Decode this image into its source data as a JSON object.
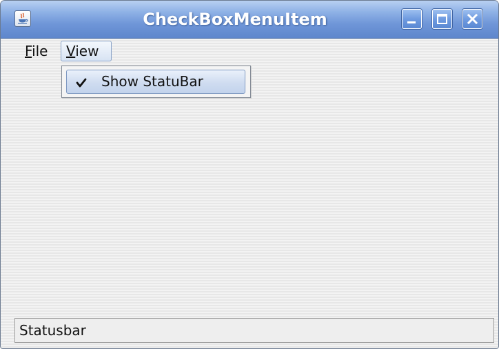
{
  "window": {
    "title": "CheckBoxMenuItem",
    "icon": "java-icon",
    "buttons": [
      {
        "name": "minimize",
        "icon": "minimize-icon"
      },
      {
        "name": "maximize",
        "icon": "maximize-icon"
      },
      {
        "name": "close",
        "icon": "close-icon"
      }
    ]
  },
  "menubar": {
    "items": [
      {
        "label": "File",
        "mnemonic": "F",
        "rest": "ile",
        "active": false
      },
      {
        "label": "View",
        "mnemonic": "V",
        "rest": "iew",
        "active": true
      }
    ]
  },
  "view_menu": {
    "items": [
      {
        "label": "Show StatuBar",
        "checked": true,
        "highlighted": true,
        "icon": "checkmark-icon"
      }
    ]
  },
  "statusbar": {
    "text": "Statusbar"
  },
  "colors": {
    "titlebar": "#6f96d8",
    "title_text": "#ffffff",
    "menu_highlight": "#cfdcf0",
    "background": "#eeeeee"
  }
}
